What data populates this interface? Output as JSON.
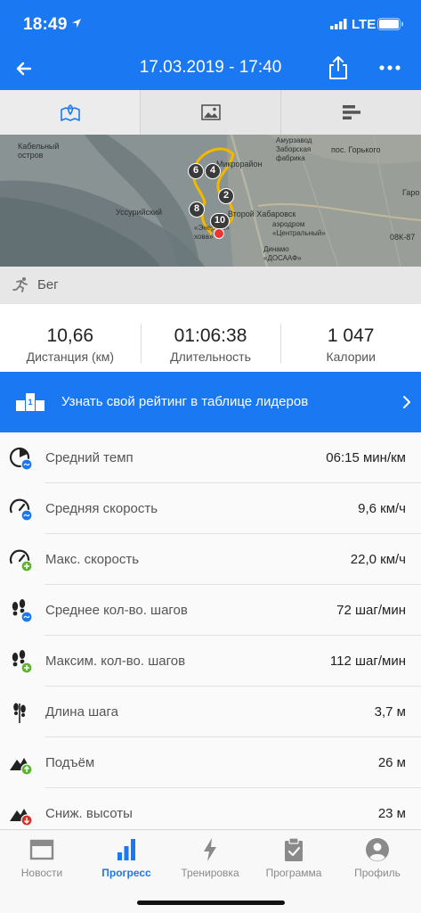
{
  "status_bar": {
    "time": "18:49",
    "network": "LTE"
  },
  "header": {
    "title": "17.03.2019 - 17:40"
  },
  "view_tabs": [
    {
      "id": "map",
      "icon": "map-icon",
      "active": true
    },
    {
      "id": "photos",
      "icon": "image-icon",
      "active": false
    },
    {
      "id": "splits",
      "icon": "bar-list-icon",
      "active": false
    }
  ],
  "map": {
    "labels": {
      "kabelny": "Кабельный\nостров",
      "amurzavod": "Амурзавод\nЗаборская\nфабрика",
      "gorkogo": "пос. Горького",
      "ussuriysky": "Уссурийский",
      "vtoroy": "Второй Хабаровск",
      "aeroport": "аэродром\n«Центральный»",
      "dinamo": "Динамо\n«ДОСААФ»",
      "mikrorayon": "Микрорайон",
      "road": "08К-87",
      "garo": "Гаро",
      "stadium": "«Энергия»\nхова»"
    },
    "markers": [
      "6",
      "4",
      "2",
      "8",
      "10"
    ]
  },
  "activity": {
    "type": "Бег",
    "icon": "running-icon"
  },
  "summary": [
    {
      "value": "10,66",
      "label": "Дистанция (км)"
    },
    {
      "value": "01:06:38",
      "label": "Длительность"
    },
    {
      "value": "1 047",
      "label": "Калории"
    }
  ],
  "leaderboard": {
    "text": "Узнать свой рейтинг в таблице лидеров"
  },
  "stats": [
    {
      "label": "Средний темп",
      "value": "06:15 мин/км",
      "icon": "pace-icon"
    },
    {
      "label": "Средняя скорость",
      "value": "9,6 км/ч",
      "icon": "speedometer-icon"
    },
    {
      "label": "Макс. скорость",
      "value": "22,0 км/ч",
      "icon": "max-speed-icon"
    },
    {
      "label": "Среднее кол-во. шагов",
      "value": "72 шаг/мин",
      "icon": "footsteps-icon"
    },
    {
      "label": "Максим. кол-во. шагов",
      "value": "112 шаг/мин",
      "icon": "max-footsteps-icon"
    },
    {
      "label": "Длина шага",
      "value": "3,7 м",
      "icon": "stride-icon"
    },
    {
      "label": "Подъём",
      "value": "26 м",
      "icon": "ascent-icon"
    },
    {
      "label": "Сниж. высоты",
      "value": "23 м",
      "icon": "descent-icon"
    }
  ],
  "bottom_nav": [
    {
      "label": "Новости",
      "icon": "news-icon",
      "active": false
    },
    {
      "label": "Прогресс",
      "icon": "progress-icon",
      "active": true
    },
    {
      "label": "Тренировка",
      "icon": "lightning-icon",
      "active": false
    },
    {
      "label": "Программа",
      "icon": "clipboard-icon",
      "active": false
    },
    {
      "label": "Профиль",
      "icon": "profile-icon",
      "active": false
    }
  ],
  "colors": {
    "primary": "#1a78f2",
    "route": "#f2b800",
    "end_marker": "#e33333"
  }
}
